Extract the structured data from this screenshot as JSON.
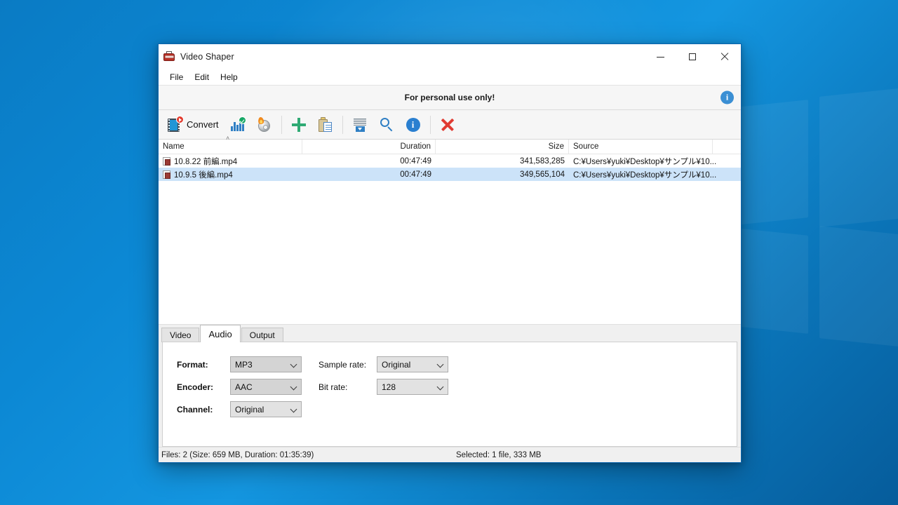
{
  "window": {
    "title": "Video Shaper",
    "app_icon": "bus-icon",
    "controls": {
      "minimize": "minimize-icon",
      "maximize": "maximize-icon",
      "close": "close-icon"
    }
  },
  "menu": {
    "items": [
      "File",
      "Edit",
      "Help"
    ]
  },
  "notice": {
    "text": "For personal use only!",
    "info_glyph": "i"
  },
  "toolbar": {
    "convert_label": "Convert",
    "items": [
      {
        "name": "convert-video-button",
        "icon": "film-play-icon"
      },
      {
        "name": "convert-audio-button",
        "icon": "equalizer-check-icon"
      },
      {
        "name": "burn-disc-button",
        "icon": "disc-flame-icon"
      },
      {
        "name": "add-file-button",
        "icon": "plus-icon"
      },
      {
        "name": "paste-button",
        "icon": "clipboard-document-icon"
      },
      {
        "name": "list-down-button",
        "icon": "list-download-icon"
      },
      {
        "name": "search-button",
        "icon": "magnifier-icon"
      },
      {
        "name": "info-button",
        "icon": "info-circle-icon"
      },
      {
        "name": "remove-button",
        "icon": "red-x-icon"
      }
    ],
    "info_glyph": "i"
  },
  "file_list": {
    "columns": [
      "Name",
      "Duration",
      "Size",
      "Source"
    ],
    "sort_indicator": "˄",
    "rows": [
      {
        "name": "10.8.22 前編.mp4",
        "duration": "00:47:49",
        "size": "341,583,285",
        "source": "C:¥Users¥yuki¥Desktop¥サンプル¥10...",
        "selected": false
      },
      {
        "name": "10.9.5 後編.mp4",
        "duration": "00:47:49",
        "size": "349,565,104",
        "source": "C:¥Users¥yuki¥Desktop¥サンプル¥10...",
        "selected": true
      }
    ]
  },
  "tabs": {
    "items": [
      "Video",
      "Audio",
      "Output"
    ],
    "active": "Audio"
  },
  "audio_panel": {
    "format": {
      "label": "Format:",
      "value": "MP3"
    },
    "encoder": {
      "label": "Encoder:",
      "value": "AAC"
    },
    "channel": {
      "label": "Channel:",
      "value": "Original"
    },
    "sample_rate": {
      "label": "Sample rate:",
      "value": "Original"
    },
    "bit_rate": {
      "label": "Bit rate:",
      "value": "128"
    }
  },
  "status": {
    "left": "Files: 2 (Size: 659 MB, Duration: 01:35:39)",
    "right": "Selected: 1 file, 333 MB"
  },
  "colors": {
    "selection": "#cce3f9",
    "accent_blue": "#2a7fd0",
    "danger_red": "#e03b32",
    "success_green": "#2faa74"
  }
}
